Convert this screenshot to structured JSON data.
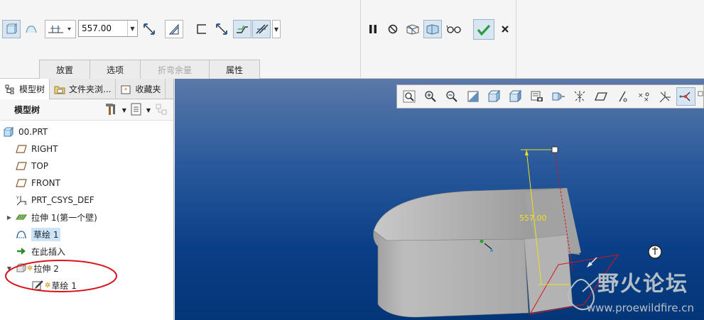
{
  "dashboard": {
    "depth_value": "557.00",
    "tabs": [
      {
        "label": "放置",
        "enabled": true
      },
      {
        "label": "选项",
        "enabled": true
      },
      {
        "label": "折弯余量",
        "enabled": false
      },
      {
        "label": "属性",
        "enabled": true
      }
    ],
    "icons_left": [
      "solid-icon",
      "surface-icon",
      "depth-blind-icon",
      "flip-depth-icon",
      "thicken-icon",
      "sheet-wall-icon",
      "flip-thickness-icon",
      "add-bend-icon",
      "remove-material-icon"
    ],
    "icons_right": [
      "pause-icon",
      "no-preview-icon",
      "preview-geometry-icon",
      "feature-preview-icon",
      "verify-icon",
      "ok-icon",
      "cancel-icon"
    ],
    "ok_color": "#2a9c3f"
  },
  "left_panel": {
    "tabs": [
      "模型树",
      "文件夹浏...",
      "收藏夹"
    ],
    "header_title": "模型树",
    "tree": [
      {
        "label": "00.PRT",
        "icon": "part-icon",
        "level": 0
      },
      {
        "label": "RIGHT",
        "icon": "datum-plane-icon",
        "level": 1
      },
      {
        "label": "TOP",
        "icon": "datum-plane-icon",
        "level": 1
      },
      {
        "label": "FRONT",
        "icon": "datum-plane-icon",
        "level": 1
      },
      {
        "label": "PRT_CSYS_DEF",
        "icon": "csys-icon",
        "level": 1
      },
      {
        "label": "拉伸 1(第一个壁)",
        "icon": "first-wall-icon",
        "level": 1,
        "expandable": true
      },
      {
        "label": "草绘 1",
        "icon": "sketch-icon",
        "level": 1,
        "selected": true
      },
      {
        "label": "在此插入",
        "icon": "insert-here-icon",
        "level": 1
      },
      {
        "label": "拉伸 2",
        "icon": "extrude-icon",
        "level": 1,
        "expanded": true,
        "new": true
      },
      {
        "label": "草绘 1",
        "icon": "sketch-edit-icon",
        "level": 2,
        "new": true
      }
    ]
  },
  "viewport": {
    "toolbar": [
      "refit-icon",
      "zoom-in-icon",
      "zoom-out-icon",
      "repaint-icon",
      "display-style-icon",
      "saved-views-icon",
      "view-manager-icon",
      "perspective-icon",
      "datum-display-icon",
      "plane-display-icon",
      "axis-display-icon",
      "point-display-icon",
      "csys-display-icon",
      "spin-center-icon"
    ],
    "dimension_label": "557.00",
    "watermark_cn": "野火论坛",
    "watermark_url": "www.proewildfire.cn",
    "background_color": "#0a3f87",
    "annotation_color": "#d8141a"
  }
}
